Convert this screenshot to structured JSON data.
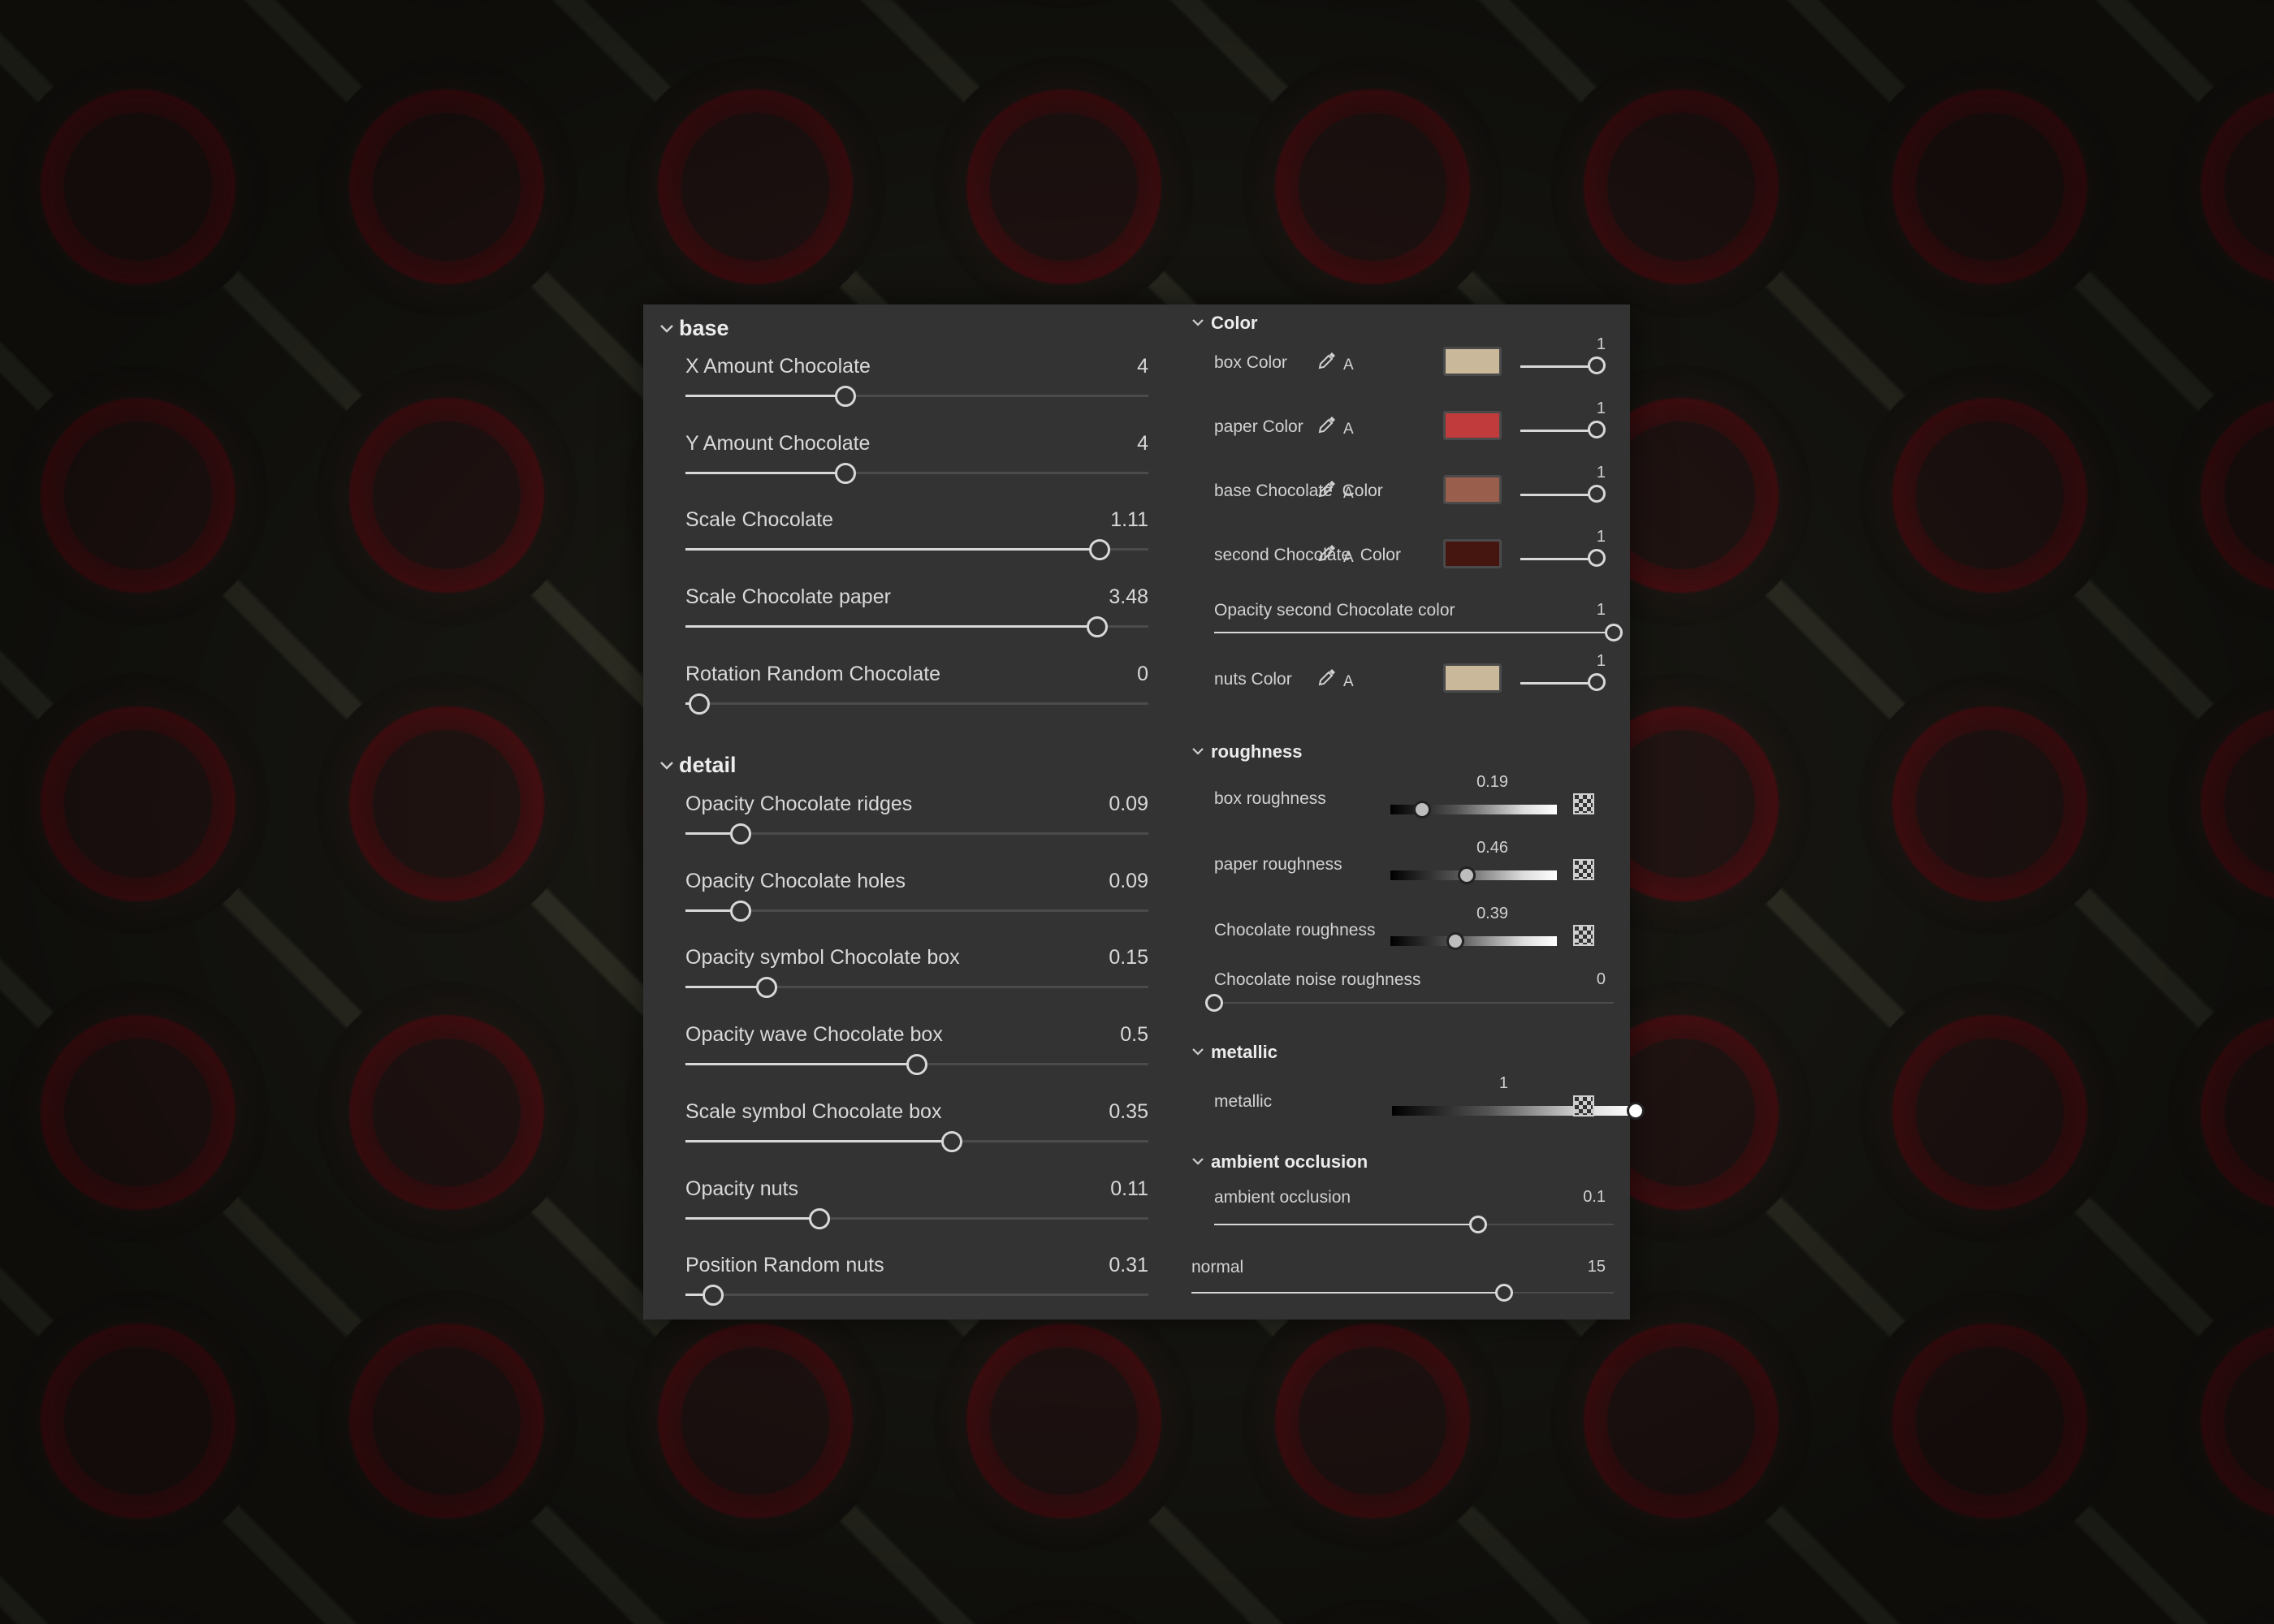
{
  "base": {
    "title": "base",
    "params": [
      {
        "label": "X Amount Chocolate",
        "value": "4",
        "fraction": 0.345
      },
      {
        "label": "Y Amount Chocolate",
        "value": "4",
        "fraction": 0.345
      },
      {
        "label": "Scale Chocolate",
        "value": "1.11",
        "fraction": 0.895
      },
      {
        "label": "Scale Chocolate paper",
        "value": "3.48",
        "fraction": 0.89
      },
      {
        "label": "Rotation Random Chocolate",
        "value": "0",
        "fraction": 0.03
      }
    ]
  },
  "detail": {
    "title": "detail",
    "params": [
      {
        "label": "Opacity Chocolate ridges",
        "value": "0.09",
        "fraction": 0.12
      },
      {
        "label": "Opacity Chocolate holes",
        "value": "0.09",
        "fraction": 0.12
      },
      {
        "label": "Opacity symbol Chocolate box",
        "value": "0.15",
        "fraction": 0.175
      },
      {
        "label": "Opacity wave Chocolate box",
        "value": "0.5",
        "fraction": 0.5
      },
      {
        "label": "Scale symbol Chocolate box",
        "value": "0.35",
        "fraction": 0.575
      },
      {
        "label": "Opacity nuts",
        "value": "0.11",
        "fraction": 0.29
      },
      {
        "label": "Position Random nuts",
        "value": "0.31",
        "fraction": 0.06
      }
    ]
  },
  "color": {
    "title": "Color",
    "alpha_label": "A",
    "items": [
      {
        "label": "box Color",
        "alpha": "1",
        "swatch": "#c9b899"
      },
      {
        "label": "paper Color",
        "alpha": "1",
        "swatch": "#c23b3c"
      },
      {
        "label": "base Chocolate  Color",
        "alpha": "1",
        "swatch": "#9a5f4c"
      },
      {
        "label": "second Chocolate  Color",
        "alpha": "1",
        "swatch": "#451510"
      }
    ],
    "opacity_second": {
      "label": "Opacity second Chocolate color",
      "value": "1",
      "fraction": 1.0
    },
    "nuts": {
      "label": "nuts Color",
      "alpha": "1",
      "swatch": "#c9b899"
    }
  },
  "roughness": {
    "title": "roughness",
    "items": [
      {
        "label": "box roughness",
        "value": "0.19",
        "fraction": 0.19
      },
      {
        "label": "paper roughness",
        "value": "0.46",
        "fraction": 0.46
      },
      {
        "label": "Chocolate roughness",
        "value": "0.39",
        "fraction": 0.39
      }
    ],
    "noise": {
      "label": "Chocolate noise roughness",
      "value": "0",
      "fraction": 0.0
    }
  },
  "metallic": {
    "title": "metallic",
    "item": {
      "label": "metallic",
      "value": "1",
      "fraction": 1.0
    }
  },
  "ambient_occlusion": {
    "title": "ambient occlusion",
    "item": {
      "label": "ambient occlusion",
      "value": "0.1",
      "fraction": 0.66
    }
  },
  "normal": {
    "label": "normal",
    "value": "15",
    "fraction": 0.74
  }
}
